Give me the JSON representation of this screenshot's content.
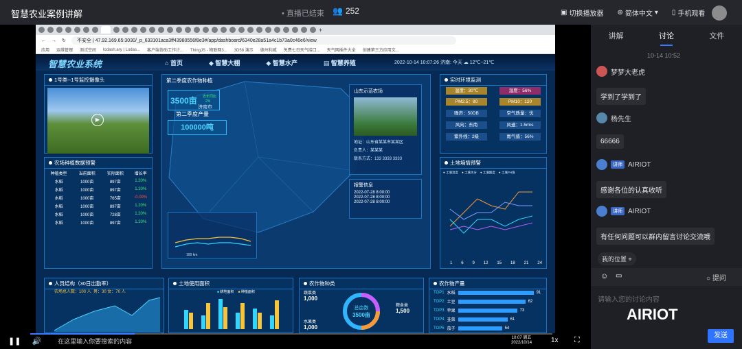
{
  "topbar": {
    "title": "智慧农业案例讲解",
    "live_status": "直播已结束",
    "viewer_count": "252",
    "switch_player": "切换播放器",
    "language": "简体中文",
    "mobile_view": "手机观看"
  },
  "browser": {
    "security": "不安全",
    "url": "47.92.169.65:3030/_p_633101aca3ff43980556f8e3#/app/dashboard/6340e28a51a4c1b73a0c46e6/view",
    "bookmarks": [
      "应用",
      "运维管理",
      "测试空间",
      "lodash.ary | Lodas...",
      "客户端协助工作计...",
      "ThingJS - 物联网3...",
      "3D58 演示",
      "德州利威",
      "免费七日天气接口...",
      "天气网插件大全",
      "创建第三方应用文..."
    ]
  },
  "dashboard": {
    "system_name": "智慧农业系统",
    "nav": [
      "首页",
      "智慧大棚",
      "智慧水产",
      "智慧养殖"
    ],
    "datetime": "2022-10-14 10:07:26",
    "city": "济南:",
    "weather": "今天",
    "temp": "12℃~21℃",
    "camera": {
      "title": "1号类--1号监控摄像头"
    },
    "warning": {
      "title": "农场种植数据预警",
      "headers": [
        "种植类型",
        "当前面积",
        "实际面积",
        "增长率"
      ],
      "rows": [
        [
          "水稻",
          "1000亩",
          "897亩",
          "1.20%"
        ],
        [
          "水稻",
          "1000亩",
          "897亩",
          "1.20%"
        ],
        [
          "水稻",
          "1000亩",
          "765亩",
          "-0.09%"
        ],
        [
          "水稻",
          "1000亩",
          "897亩",
          "1.20%"
        ],
        [
          "水稻",
          "1000亩",
          "728亩",
          "1.20%"
        ],
        [
          "水稻",
          "1000亩",
          "897亩",
          "1.20%"
        ]
      ]
    },
    "map": {
      "title": "第二季度农作物种植",
      "area": "3500亩",
      "area_unit": "去年同比",
      "area_pct": "2%",
      "yield_label": "第二季度产量",
      "yield": "100000吨",
      "city_label": "济南市",
      "scale": "100 km",
      "farm": {
        "name": "山东示范农场",
        "address": "地址：山东省某某市某某区",
        "owner": "负责人：某某某",
        "contact": "联系方式：133 3333 3333"
      },
      "alarm": {
        "title": "报警信息",
        "items": [
          "2022-07-28 8:00:00",
          "2022-07-28 8:00:00",
          "2022-07-28 8:00:00"
        ]
      }
    },
    "env": {
      "title": "实时环境监测",
      "cells": [
        "温度：30℃",
        "湿度：56%",
        "PM2.5：80",
        "PM10：120",
        "噪声：50DB",
        "空气质量：优",
        "风向：东南",
        "风速：1.5m\\s",
        "紫外线：2级",
        "氮气值：56%"
      ]
    },
    "soil": {
      "title": "土地墒情预警",
      "legend": [
        "土壤温度",
        "土壤水分",
        "土壤酸度",
        "土壤PH值"
      ],
      "xlabels": [
        "1",
        "6",
        "9",
        "12",
        "15",
        "18",
        "21",
        "24"
      ]
    },
    "staff": {
      "title": "人员结构（30日出勤率）",
      "total": "农场总人数：100 人",
      "gender": "男：30 女：70 人",
      "yticks": [
        "100",
        "80",
        "60",
        "40",
        "20",
        "0"
      ]
    },
    "land": {
      "title": "土地使用面积",
      "legend": [
        "耕地面积",
        "种植面积"
      ],
      "years": [
        "2015",
        "2016",
        "2017",
        "2018",
        "2019",
        "2020"
      ]
    },
    "crops": {
      "title": "农作物种类",
      "center": "总亩数",
      "center_val": "3500亩",
      "labels": [
        [
          "蔬菜类",
          "1,000"
        ],
        [
          "粮食类",
          "1,500"
        ],
        [
          "水果类",
          "1,000"
        ]
      ]
    },
    "output": {
      "title": "农作物产量",
      "items": [
        [
          "TOP1",
          "水稻",
          "91"
        ],
        [
          "TOP2",
          "土豆",
          "62"
        ],
        [
          "TOP3",
          "苹果",
          "73"
        ],
        [
          "TOP4",
          "韭菜",
          "61"
        ],
        [
          "TOP5",
          "茄子",
          "54"
        ]
      ]
    }
  },
  "sidebar": {
    "tabs": [
      "讲解",
      "讨论",
      "文件"
    ],
    "time": "10-14 10:52",
    "messages": [
      {
        "user": "梦梦大老虎",
        "text": "学到了学到了"
      },
      {
        "user": "杨先生",
        "text": "66666"
      },
      {
        "user": "AIRIOT",
        "tag": "讲师",
        "text": "感谢各位的认真收听"
      },
      {
        "user": "AIRIOT",
        "tag": "讲师",
        "text": "有任何问题可以群内留言讨论交流哦"
      }
    ],
    "location": "我的位置",
    "ask": "提问",
    "placeholder": "请输入您的讨论内容",
    "send": "发送",
    "watermark": "AIRIOT"
  },
  "player": {
    "speed": "1x"
  },
  "taskbar": {
    "search": "在这里输入你要搜索的内容",
    "time": "10:07 周五",
    "date": "2022/10/14"
  }
}
